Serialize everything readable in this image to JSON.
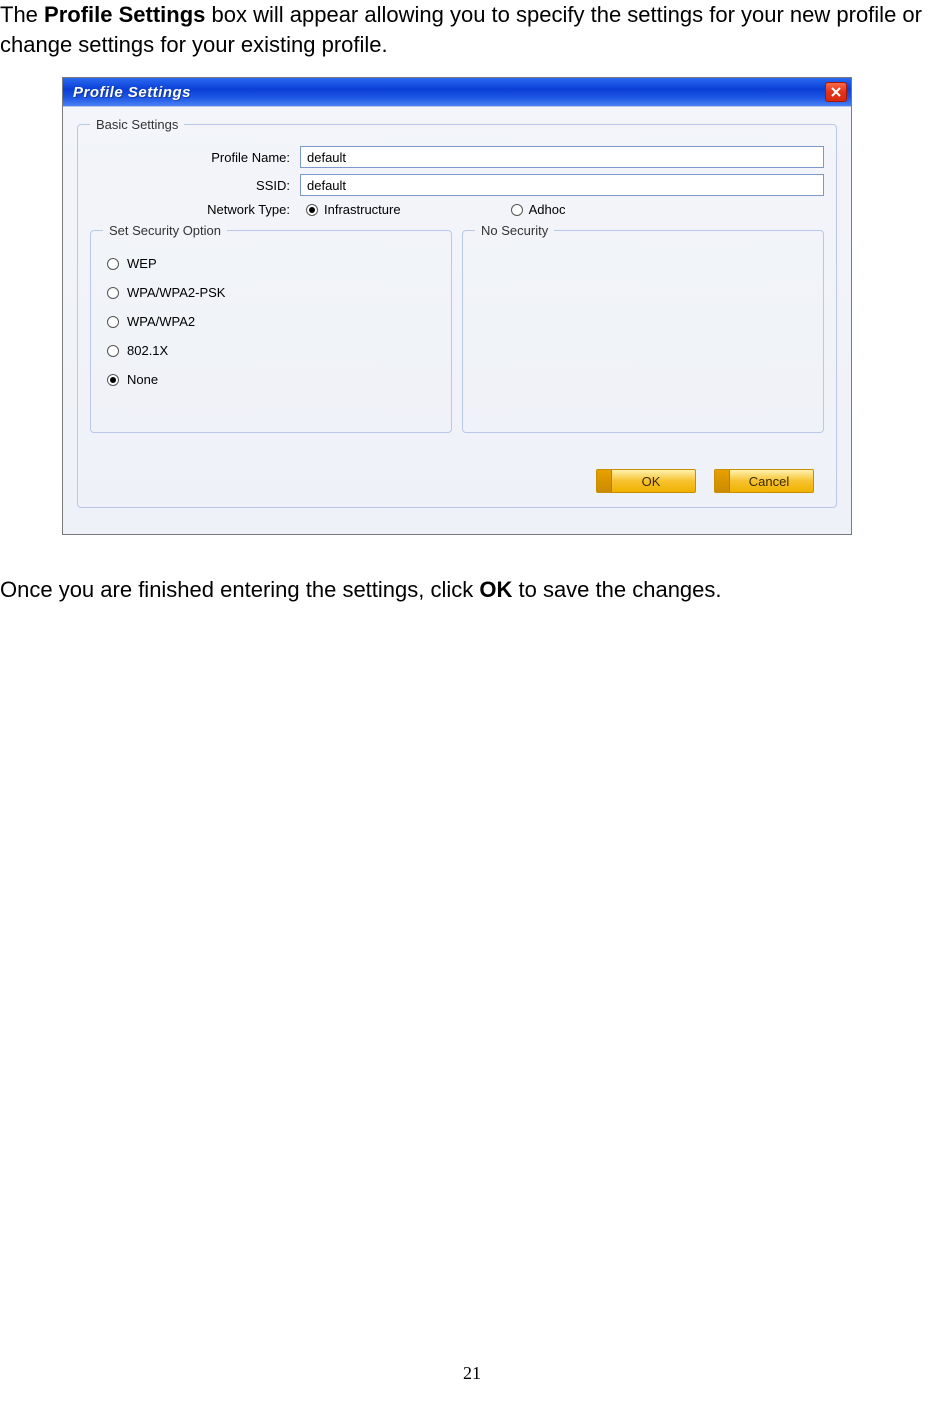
{
  "page_number": "21",
  "intro": {
    "prefix": "The ",
    "bold": "Profile Settings",
    "suffix": " box will appear allowing you to specify the settings for your new profile or change settings for your existing profile."
  },
  "outro": {
    "prefix": "Once you are finished entering the settings, click ",
    "bold": "OK",
    "suffix": " to save the changes."
  },
  "dialog": {
    "title": "Profile Settings",
    "close_label": "X",
    "groups": {
      "basic": {
        "legend": "Basic Settings",
        "profile_name_label": "Profile Name:",
        "profile_name_value": "default",
        "ssid_label": "SSID:",
        "ssid_value": "default",
        "network_type_label": "Network Type:",
        "network_type_options": {
          "infrastructure": {
            "label": "Infrastructure",
            "selected": true
          },
          "adhoc": {
            "label": "Adhoc",
            "selected": false
          }
        }
      },
      "security": {
        "legend": "Set Security Option",
        "options": [
          {
            "label": "WEP",
            "selected": false
          },
          {
            "label": "WPA/WPA2-PSK",
            "selected": false
          },
          {
            "label": "WPA/WPA2",
            "selected": false
          },
          {
            "label": "802.1X",
            "selected": false
          },
          {
            "label": "None",
            "selected": true
          }
        ]
      },
      "no_security": {
        "legend": "No Security"
      }
    },
    "buttons": {
      "ok": "OK",
      "cancel": "Cancel"
    }
  }
}
